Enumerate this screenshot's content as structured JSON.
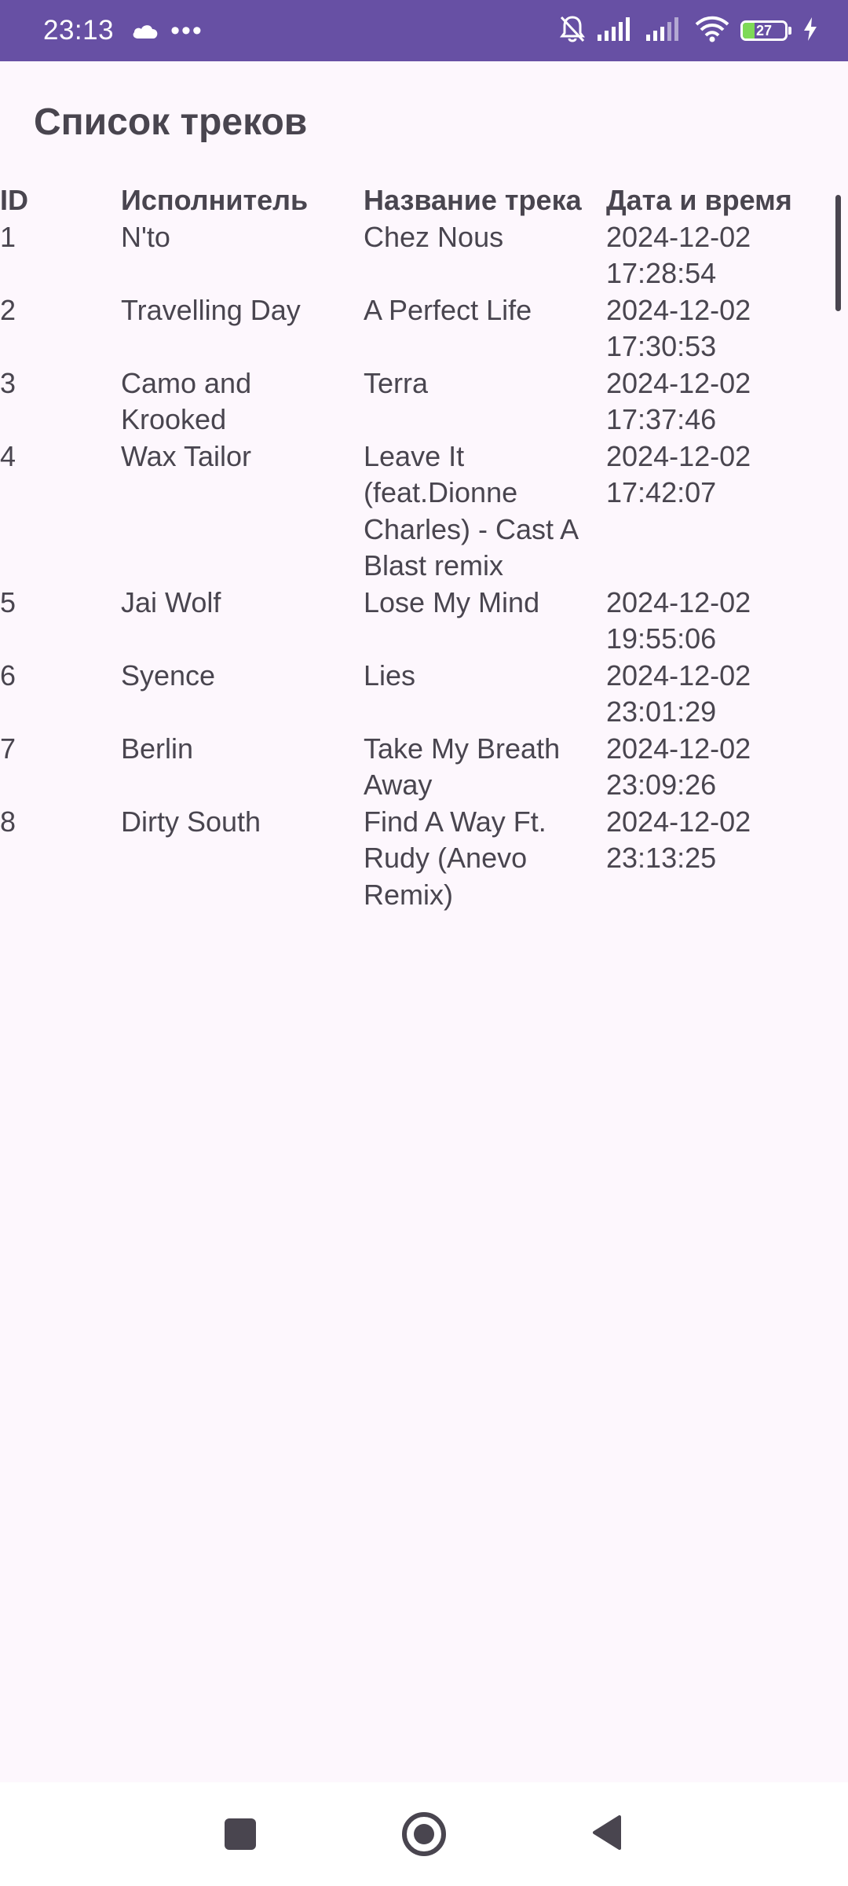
{
  "status_bar": {
    "time": "23:13",
    "icons": [
      "cloud-icon",
      "more-icon",
      "mute-bell-icon",
      "signal-icon",
      "signal-icon-2",
      "wifi-icon",
      "battery-icon",
      "charging-icon"
    ],
    "more_glyph": "•••",
    "battery_percent": "27",
    "battery_level": 0.27
  },
  "page": {
    "title": "Список треков"
  },
  "table": {
    "headers": {
      "id": "ID",
      "artist": "Исполнитель",
      "title": "Название трека",
      "datetime": "Дата и время"
    },
    "rows": [
      {
        "id": "1",
        "artist": "N'to",
        "title": "Chez Nous",
        "date": "2024-12-02",
        "time": "17:28:54"
      },
      {
        "id": "2",
        "artist": "Travelling Day",
        "title": "A Perfect Life",
        "date": "2024-12-02",
        "time": "17:30:53"
      },
      {
        "id": "3",
        "artist": "Camo and Krooked",
        "title": "Terra",
        "date": "2024-12-02",
        "time": "17:37:46"
      },
      {
        "id": "4",
        "artist": "Wax Tailor",
        "title": "Leave It (feat.Dionne Charles) - Cast A Blast remix",
        "date": "2024-12-02",
        "time": "17:42:07"
      },
      {
        "id": "5",
        "artist": "Jai Wolf",
        "title": "Lose My Mind",
        "date": "2024-12-02",
        "time": "19:55:06"
      },
      {
        "id": "6",
        "artist": "Syence",
        "title": "Lies",
        "date": "2024-12-02",
        "time": "23:01:29"
      },
      {
        "id": "7",
        "artist": "Berlin",
        "title": "Take My Breath Away",
        "date": "2024-12-02",
        "time": "23:09:26"
      },
      {
        "id": "8",
        "artist": "Dirty South",
        "title": "Find A Way Ft. Rudy (Anevo Remix)",
        "date": "2024-12-02",
        "time": "23:13:25"
      }
    ]
  },
  "nav_bar": {
    "icons": [
      "recents-icon",
      "home-icon",
      "back-icon"
    ]
  },
  "colors": {
    "status_bar_bg": "#6750a4",
    "page_bg": "#fdf7fd",
    "text": "#49454f",
    "battery_fill": "#7ed957"
  }
}
